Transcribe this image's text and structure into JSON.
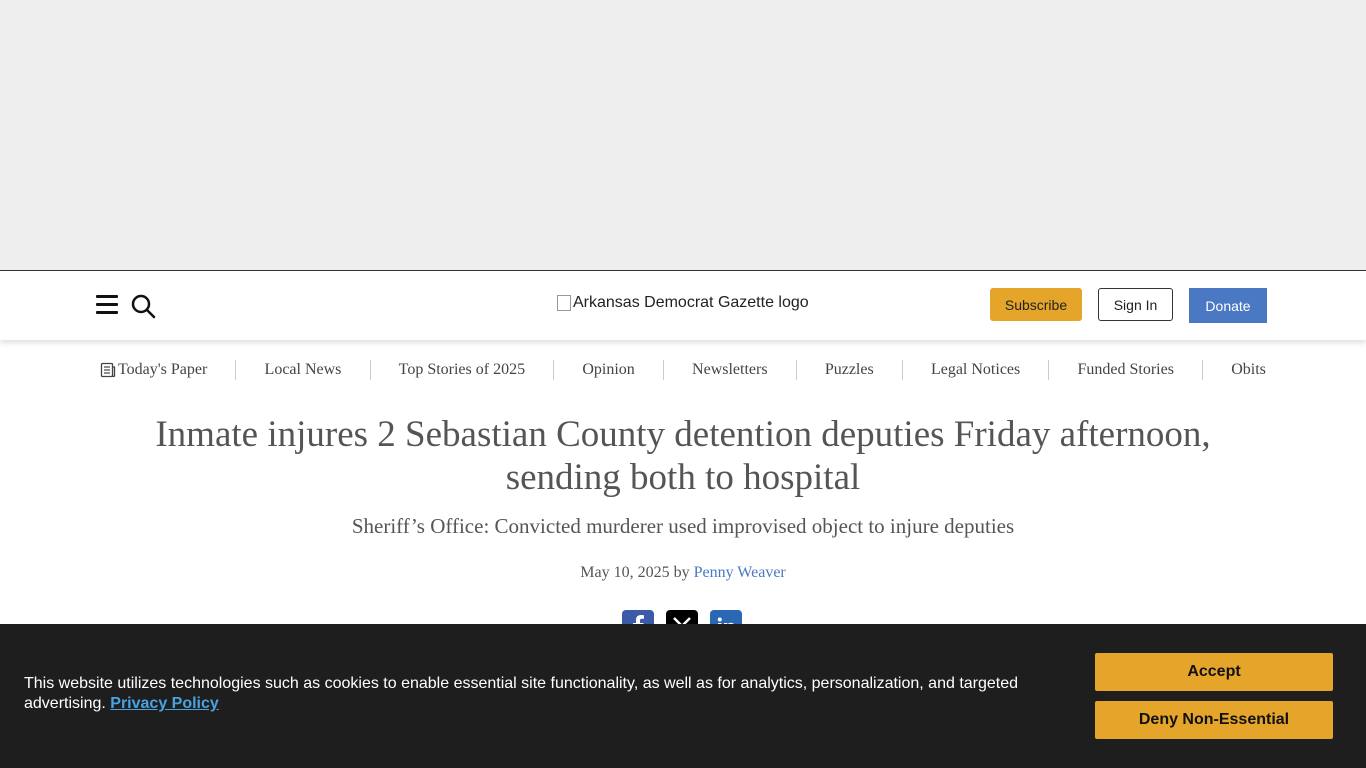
{
  "header": {
    "logo_alt": "Arkansas Democrat Gazette logo",
    "subscribe_label": "Subscribe",
    "signin_label": "Sign In",
    "donate_label": "Donate",
    "icons": [
      "menu-icon",
      "search-icon"
    ]
  },
  "nav": {
    "items": [
      {
        "label": "Today's Paper",
        "icon": "newspaper-icon"
      },
      {
        "label": "Local News"
      },
      {
        "label": "Top Stories of 2025"
      },
      {
        "label": "Opinion"
      },
      {
        "label": "Newsletters"
      },
      {
        "label": "Puzzles"
      },
      {
        "label": "Legal Notices"
      },
      {
        "label": "Funded Stories"
      },
      {
        "label": "Obits"
      }
    ]
  },
  "article": {
    "headline": "Inmate injures 2 Sebastian County detention deputies Friday afternoon, sending both to hospital",
    "subhead": "Sheriff’s Office: Convicted murderer used improvised object to injure deputies",
    "date": "May 10, 2025",
    "by": "by",
    "author": "Penny Weaver",
    "share_icons": [
      "facebook-icon",
      "x-icon",
      "linkedin-icon"
    ]
  },
  "cookie_banner": {
    "text": "This website utilizes technologies such as cookies to enable essential site functionality, as well as for analytics, personalization, and targeted advertising.",
    "privacy_link": "Privacy Policy",
    "accept_label": "Accept",
    "deny_label": "Deny Non-Essential"
  },
  "colors": {
    "accent_gold": "#e5a42a",
    "donate_blue": "#4a78c2",
    "banner_bg": "#1e1e1e"
  }
}
